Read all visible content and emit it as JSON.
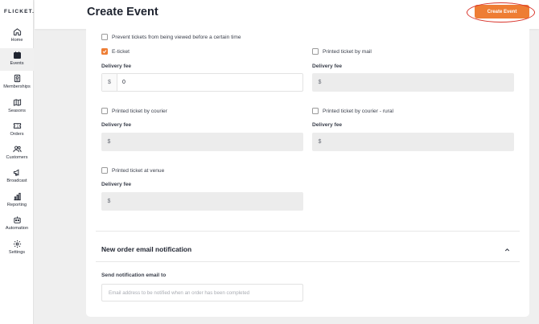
{
  "app": {
    "logo": "FLICKET."
  },
  "sidebar": {
    "items": [
      {
        "label": "Home",
        "icon": "home-icon"
      },
      {
        "label": "Events",
        "icon": "calendar-icon",
        "active": true
      },
      {
        "label": "Memberships",
        "icon": "membership-icon"
      },
      {
        "label": "Seasons",
        "icon": "map-icon"
      },
      {
        "label": "Orders",
        "icon": "ticket-icon"
      },
      {
        "label": "Customers",
        "icon": "users-icon"
      },
      {
        "label": "Broadcast",
        "icon": "megaphone-icon"
      },
      {
        "label": "Reporting",
        "icon": "bar-chart-icon"
      },
      {
        "label": "Automation",
        "icon": "robot-icon"
      },
      {
        "label": "Settings",
        "icon": "gear-icon"
      }
    ]
  },
  "header": {
    "title": "Create Event",
    "create_button": "Create Event"
  },
  "form": {
    "prevent_view": {
      "label": "Prevent tickets from being viewed before a certain time",
      "checked": false
    },
    "delivery_fee_label": "Delivery fee",
    "currency_symbol": "$",
    "eticket": {
      "label": "E-ticket",
      "checked": true,
      "fee": "0"
    },
    "printed_mail": {
      "label": "Printed ticket by mail",
      "checked": false,
      "fee": ""
    },
    "printed_courier": {
      "label": "Printed ticket by courier",
      "checked": false,
      "fee": ""
    },
    "printed_courier_rural": {
      "label": "Printed ticket by courier - rural",
      "checked": false,
      "fee": ""
    },
    "printed_venue": {
      "label": "Printed ticket at venue",
      "checked": false,
      "fee": ""
    }
  },
  "notification": {
    "section_title": "New order email notification",
    "email_label": "Send notification email to",
    "email_placeholder": "Email address to be notified when an order has been completed",
    "email_value": ""
  },
  "colors": {
    "accent": "#ee7d34",
    "highlight_ring": "#d9342b"
  }
}
